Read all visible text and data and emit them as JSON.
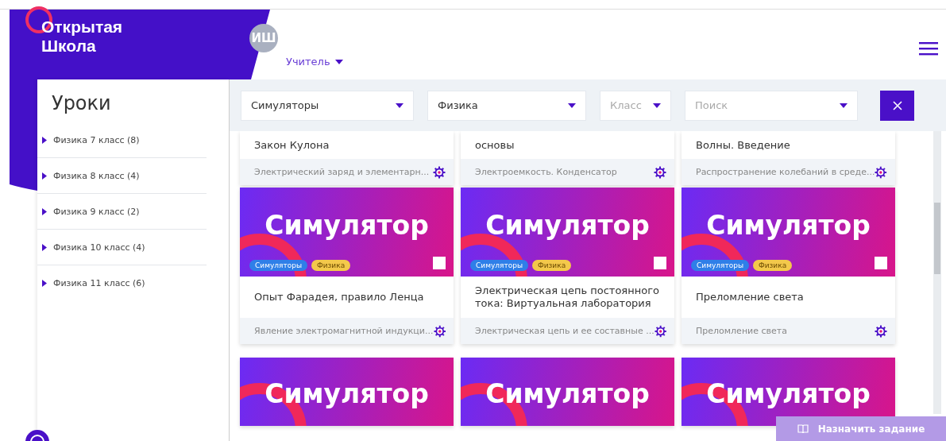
{
  "logo": {
    "line1": "Открытая",
    "line2": "Школа"
  },
  "user": {
    "initials": "ИШ",
    "role": "Учитель"
  },
  "sidebar": {
    "title": "Уроки",
    "items": [
      {
        "label": "Физика 7 класс (8)",
        "expanded": false
      },
      {
        "label": "Физика 8 класс (4)",
        "expanded": false
      },
      {
        "label": "Физика 9 класс (2)",
        "expanded": false
      },
      {
        "label": "Физика 10 класс (4)",
        "expanded": false
      },
      {
        "label": "Физика 11 класс (6)",
        "expanded": false
      }
    ]
  },
  "filters": [
    {
      "kind": "value",
      "text": "Симуляторы"
    },
    {
      "kind": "value",
      "text": "Физика"
    },
    {
      "kind": "placeholder",
      "text": "Класс"
    },
    {
      "kind": "placeholder",
      "text": "Поиск"
    }
  ],
  "cards": [
    {
      "kind": "partial",
      "title": "Закон Кулона",
      "topic": "Электрический заряд и элементарн..."
    },
    {
      "kind": "partial",
      "title": "основы",
      "topic": "Электроемкость. Конденсатор"
    },
    {
      "kind": "partial",
      "title": "Волны. Введение",
      "topic": "Распространение колебаний в среде..."
    },
    {
      "kind": "full",
      "cover": "Симулятор",
      "tags": [
        {
          "label": "Симуляторы",
          "color": "#2f7fe8"
        },
        {
          "label": "Физика",
          "color": "#f3c84b"
        }
      ],
      "checked": false,
      "title": "Опыт Фарадея, правило Ленца",
      "topic": "Явление электромагнитной индукци..."
    },
    {
      "kind": "full",
      "cover": "Симулятор",
      "tags": [
        {
          "label": "Симуляторы",
          "color": "#2f7fe8"
        },
        {
          "label": "Физика",
          "color": "#f3c84b"
        }
      ],
      "checked": false,
      "title": "Электрическая цепь постоянного тока: Виртуальная лаборатория",
      "topic": "Электрическая цепь и ее составные ..."
    },
    {
      "kind": "full",
      "cover": "Симулятор",
      "tags": [
        {
          "label": "Симуляторы",
          "color": "#2f7fe8"
        },
        {
          "label": "Физика",
          "color": "#f3c84b"
        }
      ],
      "checked": false,
      "title": "Преломление света",
      "topic": "Преломление света"
    },
    {
      "kind": "cover",
      "cover": "Симулятор"
    },
    {
      "kind": "cover",
      "cover": "Симулятор"
    },
    {
      "kind": "cover",
      "cover": "Симулятор"
    }
  ],
  "assign_button": "Назначить задание"
}
